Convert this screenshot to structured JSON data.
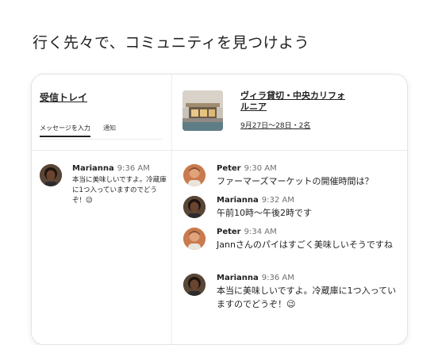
{
  "headline": "行く先々で、コミュニティを見つけよう",
  "inbox": {
    "title": "受信トレイ",
    "tabs": [
      {
        "label": "メッセージを入力"
      },
      {
        "label": "通知"
      }
    ],
    "preview": {
      "name": "Marianna",
      "time": "9:36 AM",
      "text": "本当に美味しいですよ。冷蔵庫に1つ入っていますのでどうぞ！😉"
    }
  },
  "listing": {
    "title": "ヴィラ貸切・中央カリフォルニア",
    "dates": "9月27日～28日・2名"
  },
  "messages": [
    {
      "name": "Peter",
      "time": "9:30 AM",
      "text": "ファーマーズマーケットの開催時間は？",
      "avatar": "peter"
    },
    {
      "name": "Marianna",
      "time": "9:32 AM",
      "text": "午前10時〜午後2時です",
      "avatar": "marianna"
    },
    {
      "name": "Peter",
      "time": "9:34 AM",
      "text": "Jannさんのパイはすごく美味しいそうですね",
      "avatar": "peter"
    },
    {
      "name": "Marianna",
      "time": "9:36 AM",
      "text": "本当に美味しいですよ。冷蔵庫に1つ入っていますのでどうぞ！😉",
      "avatar": "marianna"
    }
  ]
}
